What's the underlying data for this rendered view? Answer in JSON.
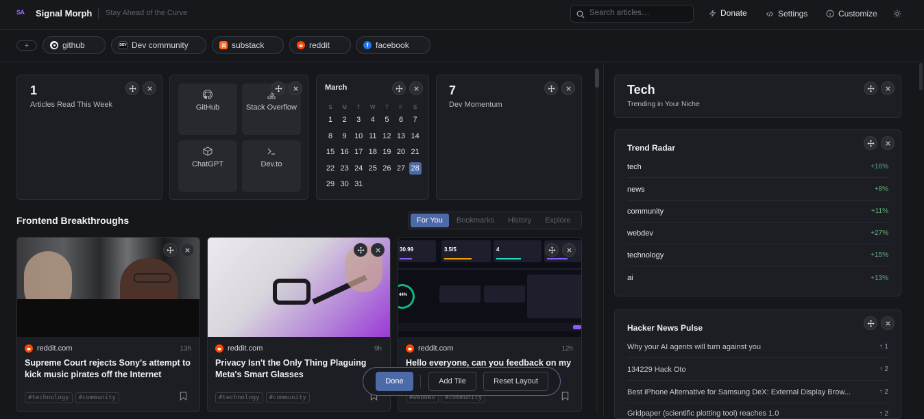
{
  "app": {
    "name": "Signal Morph",
    "logo": "SA",
    "tagline": "Stay Ahead of the Curve"
  },
  "header": {
    "search_placeholder": "Search articles…",
    "donate": "Donate",
    "settings": "Settings",
    "customize": "Customize"
  },
  "sources": [
    {
      "label": "github",
      "icon": "github-icon"
    },
    {
      "label": "Dev community",
      "icon": "dev-icon",
      "icon_text": "DEV"
    },
    {
      "label": "substack",
      "icon": "substack-icon"
    },
    {
      "label": "reddit",
      "icon": "reddit-icon"
    },
    {
      "label": "facebook",
      "icon": "facebook-icon",
      "icon_text": "f"
    }
  ],
  "stats": {
    "read": {
      "value": "1",
      "label": "Articles Read This Week"
    },
    "momentum": {
      "value": "7",
      "label": "Dev Momentum"
    }
  },
  "quick_links": [
    "GitHub",
    "Stack Overflow",
    "ChatGPT",
    "Dev.to"
  ],
  "calendar": {
    "month": "March",
    "day_headers": [
      "S",
      "M",
      "T",
      "W",
      "T",
      "F",
      "S"
    ],
    "weeks": [
      [
        "1",
        "2",
        "3",
        "4",
        "5",
        "6",
        "7"
      ],
      [
        "8",
        "9",
        "10",
        "11",
        "12",
        "13",
        "14"
      ],
      [
        "15",
        "16",
        "17",
        "18",
        "19",
        "20",
        "21"
      ],
      [
        "22",
        "23",
        "24",
        "25",
        "26",
        "27",
        "28"
      ],
      [
        "29",
        "30",
        "31"
      ]
    ],
    "today": "28"
  },
  "feed": {
    "title": "Frontend Breakthroughs",
    "tabs": [
      "For You",
      "Bookmarks",
      "History",
      "Explore"
    ],
    "active_tab": "For You",
    "articles": [
      {
        "source": "reddit.com",
        "time": "13h",
        "title": "Supreme Court rejects Sony's attempt to kick music pirates off the Internet",
        "tags": [
          "#technology",
          "#community"
        ]
      },
      {
        "source": "reddit.com",
        "time": "9h",
        "title": "Privacy Isn't the Only Thing Plaguing Meta's Smart Glasses",
        "tags": [
          "#technology",
          "#community"
        ]
      },
      {
        "source": "reddit.com",
        "time": "12h",
        "title": "Hello everyone, can you feedback on my",
        "tags": [
          "#webdev",
          "#community"
        ],
        "thumb_stats": [
          "30.99",
          "3.5/5",
          "4"
        ],
        "thumb_ring": "44%"
      }
    ]
  },
  "niche": {
    "title": "Tech",
    "subtitle": "Trending in Your Niche"
  },
  "trend_radar": {
    "title": "Trend Radar",
    "items": [
      {
        "label": "tech",
        "change": "+16%"
      },
      {
        "label": "news",
        "change": "+8%"
      },
      {
        "label": "community",
        "change": "+11%"
      },
      {
        "label": "webdev",
        "change": "+27%"
      },
      {
        "label": "technology",
        "change": "+15%"
      },
      {
        "label": "ai",
        "change": "+13%"
      }
    ]
  },
  "hacker_news": {
    "title": "Hacker News Pulse",
    "items": [
      {
        "title": "Why your AI agents will turn against you",
        "score": "↑ 1"
      },
      {
        "title": "134229 Hack Oto",
        "score": "↑ 2"
      },
      {
        "title": "Best iPhone Alternative for Samsung DeX: External Display Brow...",
        "score": "↑ 2"
      },
      {
        "title": "Gridpaper (scientific plotting tool) reaches 1.0",
        "score": "↑ 2"
      }
    ]
  },
  "edit_bar": {
    "done": "Done",
    "add_tile": "Add Tile",
    "reset": "Reset Layout"
  },
  "colors": {
    "accent": "#4d6aa8",
    "bg": "#16171b",
    "card": "#1d1e23",
    "positive": "#5fae79",
    "reddit": "#ff4500"
  }
}
